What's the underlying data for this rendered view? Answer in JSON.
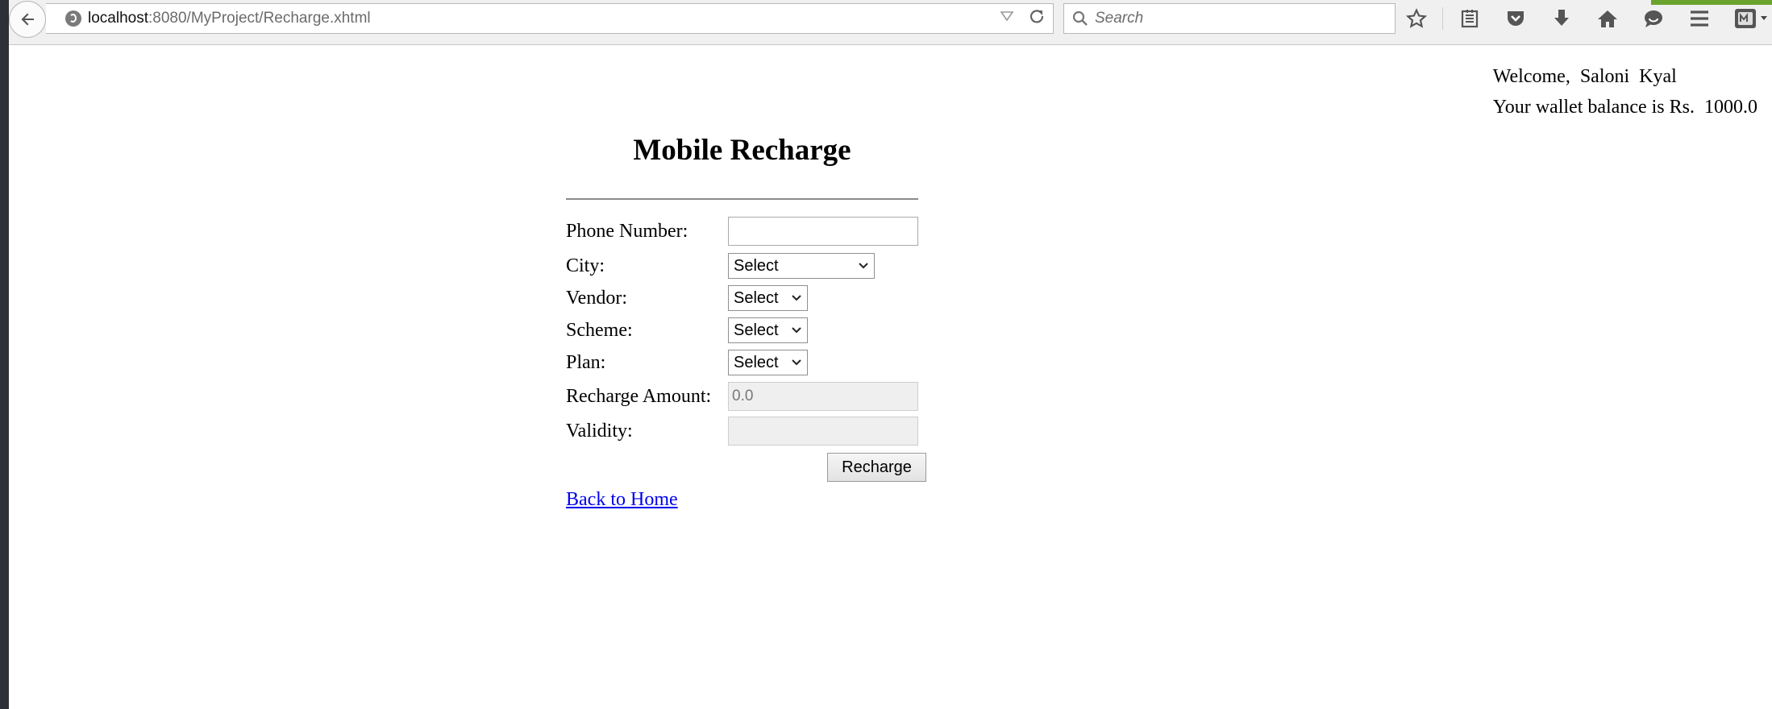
{
  "browser": {
    "url_host": "localhost",
    "url_path": ":8080/MyProject/Recharge.xhtml",
    "search_placeholder": "Search"
  },
  "header": {
    "welcome_text": "Welcome,  Saloni  Kyal",
    "wallet_text": "Your wallet balance is Rs.  1000.0"
  },
  "form": {
    "title": "Mobile Recharge",
    "phone_label": "Phone Number:",
    "phone_value": "",
    "city_label": "City:",
    "city_value": "Select",
    "vendor_label": "Vendor:",
    "vendor_value": "Select",
    "scheme_label": "Scheme:",
    "scheme_value": "Select",
    "plan_label": "Plan:",
    "plan_value": "Select",
    "amount_label": "Recharge Amount:",
    "amount_value": "0.0",
    "validity_label": "Validity:",
    "validity_value": "",
    "recharge_button": "Recharge",
    "back_link": "Back to Home"
  },
  "colors": {
    "link": "#0000ee",
    "chrome_bg": "#2d3137",
    "toolbar_bg": "#f0f0f0",
    "accent_green": "#6aa42e"
  },
  "icons": [
    "back-arrow-icon",
    "globe-icon",
    "dropmarker-icon",
    "reload-icon",
    "search-icon",
    "star-icon",
    "reading-list-icon",
    "pocket-icon",
    "download-icon",
    "home-icon",
    "chat-icon",
    "menu-icon",
    "extension-icon"
  ]
}
